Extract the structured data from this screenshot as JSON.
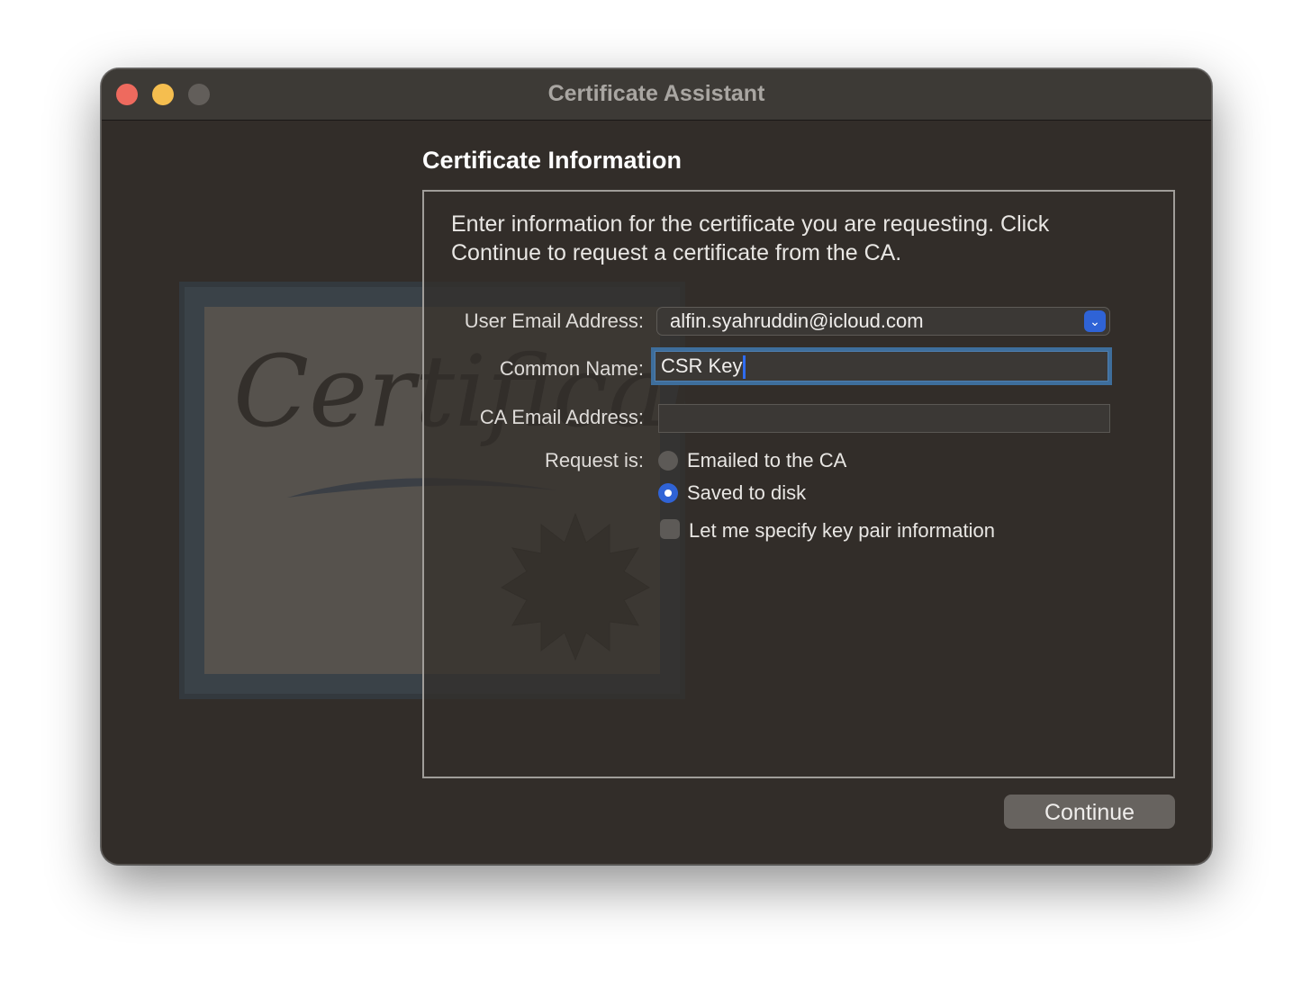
{
  "window": {
    "title": "Certificate Assistant"
  },
  "traffic_lights": [
    "close",
    "minimize",
    "zoom"
  ],
  "header": {
    "title": "Certificate Information"
  },
  "panel": {
    "description": "Enter information for the certificate you are requesting. Click Continue to request a certificate from the CA.",
    "fields": {
      "user_email": {
        "label": "User Email Address:",
        "value": "alfin.syahruddin@icloud.com",
        "icon": "chevron-down-icon"
      },
      "common_name": {
        "label": "Common Name:",
        "value": "CSR Key"
      },
      "ca_email": {
        "label": "CA Email Address:",
        "value": ""
      },
      "request_is": {
        "label": "Request is:",
        "options": [
          {
            "label": "Emailed to the CA",
            "selected": false
          },
          {
            "label": "Saved to disk",
            "selected": true
          }
        ]
      },
      "key_pair": {
        "label": "Let me specify key pair information",
        "checked": false
      }
    }
  },
  "illustration": {
    "script_text": "Certificate"
  },
  "footer": {
    "continue_label": "Continue"
  },
  "colors": {
    "accent": "#2f63d6",
    "focus_ring": "#3e6e9c",
    "close": "#ee6a5e",
    "minimize": "#f5be4f"
  }
}
